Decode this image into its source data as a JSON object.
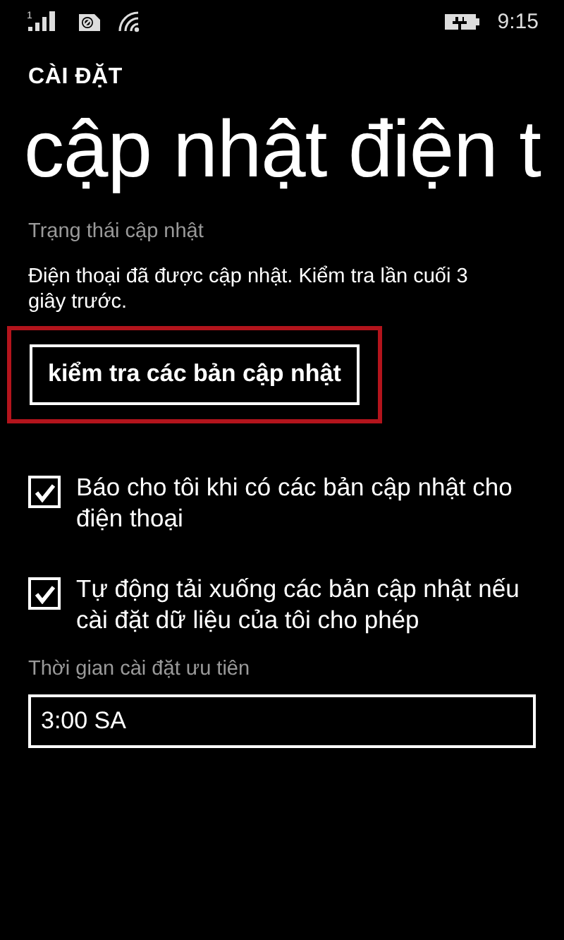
{
  "status_bar": {
    "time": "9:15",
    "sim_label": "1"
  },
  "header": {
    "app": "CÀI ĐẶT",
    "title": "cập nhật điện t"
  },
  "update_status": {
    "label": "Trạng thái cập nhật",
    "message": "Điện thoại đã được cập nhật. Kiểm tra lần cuối 3 giây trước."
  },
  "check_button": {
    "label": "kiểm tra các bản cập nhật",
    "highlighted": true
  },
  "options": [
    {
      "label": "Báo cho tôi khi có các bản cập nhật cho điện thoại",
      "checked": true
    },
    {
      "label": "Tự động tải xuống các bản cập nhật nếu cài đặt dữ liệu của tôi cho phép",
      "checked": true
    }
  ],
  "install_time": {
    "label": "Thời gian cài đặt ưu tiên",
    "value": "3:00 SA"
  }
}
